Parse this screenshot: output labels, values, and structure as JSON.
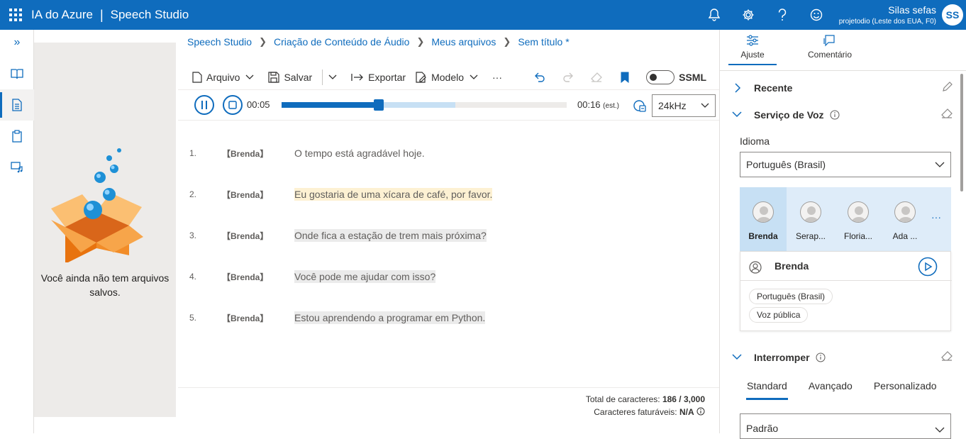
{
  "header": {
    "service": "IA do Azure",
    "separator": "|",
    "product": "Speech Studio",
    "user_name": "Silas sefas",
    "user_project": "projetodio (Leste dos EUA, F0)",
    "avatar_initials": "SS",
    "icons": [
      "bell-icon",
      "gear-icon",
      "help-icon",
      "feedback-icon"
    ]
  },
  "leftnav": {
    "expand_icon": "»",
    "items": [
      "book-icon",
      "document-icon",
      "clipboard-icon",
      "audio-file-icon"
    ]
  },
  "files": {
    "empty_text": "Você ainda não tem arquivos salvos."
  },
  "breadcrumb": [
    "Speech Studio",
    "Criação de Conteúdo de Áudio",
    "Meus arquivos",
    "Sem título *"
  ],
  "toolbar": {
    "file_label": "Arquivo",
    "save_label": "Salvar",
    "export_label": "Exportar",
    "template_label": "Modelo",
    "more_label": "···",
    "ssml_label": "SSML"
  },
  "player": {
    "current_time": "00:05",
    "total_time": "00:16",
    "est_label": "(est.)",
    "progress": 0.34,
    "buffered": 0.61,
    "sample_rate": "24kHz"
  },
  "lines": [
    {
      "num": "1.",
      "speaker": "【Brenda】",
      "text": "O tempo está agradável hoje.",
      "highlight": "none"
    },
    {
      "num": "2.",
      "speaker": "【Brenda】",
      "text": "Eu gostaria de uma xícara de café, por favor.",
      "highlight": "yellow"
    },
    {
      "num": "3.",
      "speaker": "【Brenda】",
      "text": "Onde fica a estação de trem mais próxima?",
      "highlight": "gray"
    },
    {
      "num": "4.",
      "speaker": "【Brenda】",
      "text": "Você pode me ajudar com isso?",
      "highlight": "gray"
    },
    {
      "num": "5.",
      "speaker": "【Brenda】",
      "text": "Estou aprendendo a programar em Python.",
      "highlight": "gray"
    }
  ],
  "footer": {
    "chars_label": "Total de caracteres:",
    "chars_value": "186 / 3,000",
    "billable_label": "Caracteres faturáveis:",
    "billable_value": "N/A"
  },
  "right_panel": {
    "tab_adjust": "Ajuste",
    "tab_comment": "Comentário",
    "recent": "Recente",
    "voice_service": "Serviço de Voz",
    "language_label": "Idioma",
    "language_value": "Português (Brasil)",
    "voices": [
      "Brenda",
      "Serap...",
      "Floria...",
      "Ada ..."
    ],
    "voices_more": "···",
    "selected_voice": "Brenda",
    "chips": [
      "Português (Brasil)",
      "Voz pública"
    ],
    "break_section": "Interromper",
    "break_tabs": [
      "Standard",
      "Avançado",
      "Personalizado"
    ],
    "break_value": "Padrão"
  },
  "colors": {
    "accent": "#0f6cbd",
    "highlight_yellow": "#fdf1d3",
    "highlight_gray": "#ebebeb"
  }
}
